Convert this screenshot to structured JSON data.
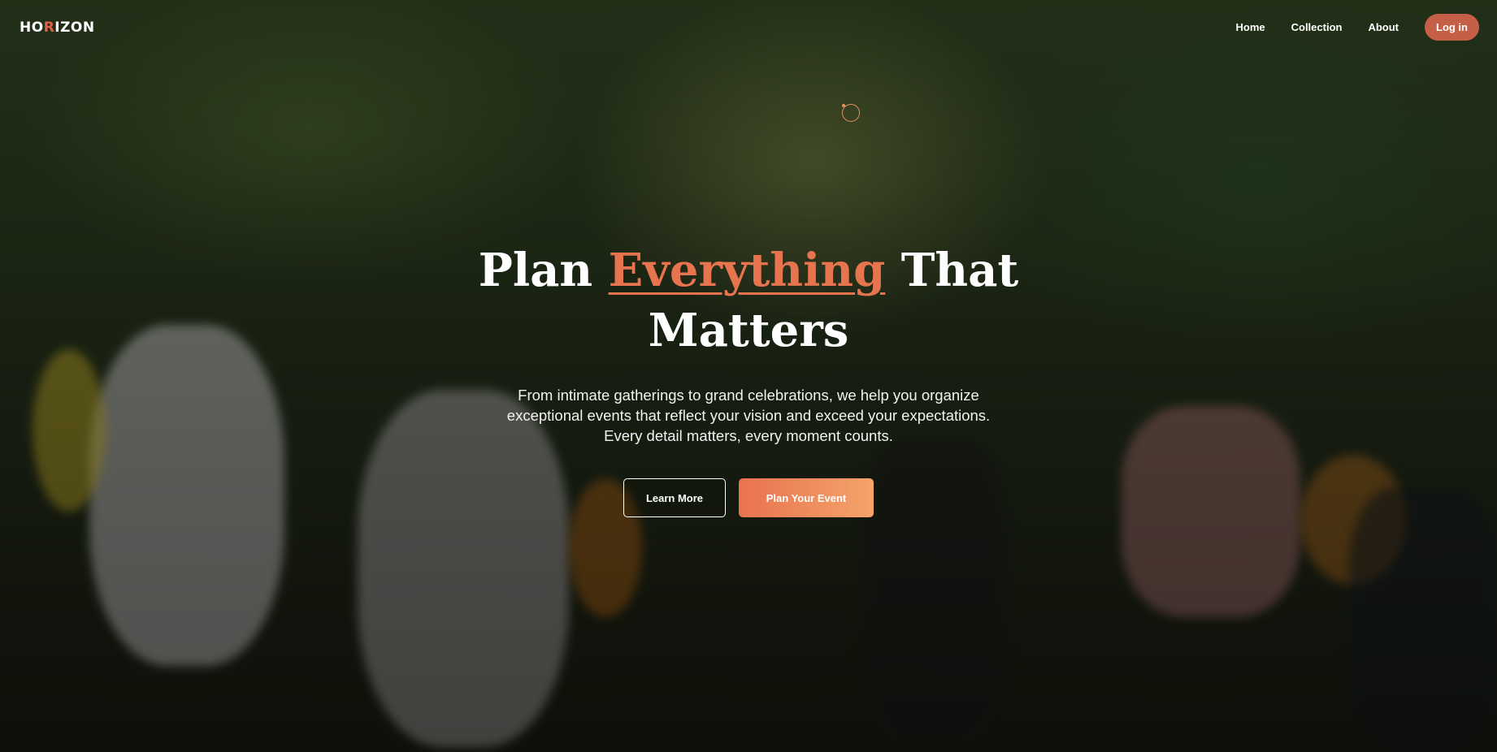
{
  "brand": {
    "prefix": "HO",
    "accent_letter": "R",
    "suffix": "IZON"
  },
  "nav": {
    "items": [
      {
        "label": "Home"
      },
      {
        "label": "Collection"
      },
      {
        "label": "About"
      }
    ],
    "login_label": "Log in"
  },
  "hero": {
    "title_before": "Plan ",
    "title_highlight": "Everything",
    "title_after_line1": " That",
    "title_line2": "Matters",
    "subtitle": "From intimate gatherings to grand celebrations, we help you organize exceptional events that reflect your vision and exceed your expectations. Every detail matters, every moment counts.",
    "secondary_cta": "Learn More",
    "primary_cta": "Plan Your Event"
  },
  "colors": {
    "accent": "#e0634a",
    "login_bg": "#c65f47",
    "cta_gradient_start": "#e8734f",
    "cta_gradient_end": "#f5a46a"
  },
  "icons": {
    "cursor": "cursor-ring-icon"
  }
}
